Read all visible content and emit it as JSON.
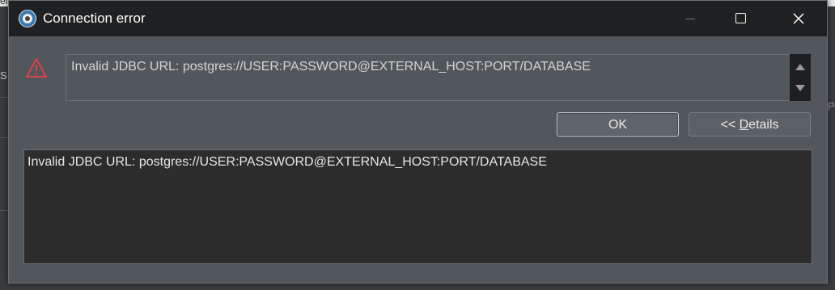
{
  "background": {
    "top_text": "erfi",
    "left_text": "S",
    "right_text": "P"
  },
  "dialog": {
    "title": "Connection error",
    "app_icon": "dbeaver-icon",
    "window_controls": {
      "minimize": "minimize-icon",
      "maximize": "maximize-icon",
      "close": "close-icon"
    },
    "warning_icon": "warning-triangle-icon",
    "message": "Invalid JDBC URL: postgres://USER:PASSWORD@EXTERNAL_HOST:PORT/DATABASE",
    "buttons": {
      "ok": "OK",
      "details_prefix": "<< ",
      "details_mnemonic": "D",
      "details_rest": "etails"
    },
    "details_text": "Invalid JDBC URL: postgres://USER:PASSWORD@EXTERNAL_HOST:PORT/DATABASE"
  },
  "colors": {
    "titlebar": "#1f2022",
    "dialog_bg": "#51575b",
    "details_bg": "#2c2c2c",
    "warning": "#e0404a"
  }
}
